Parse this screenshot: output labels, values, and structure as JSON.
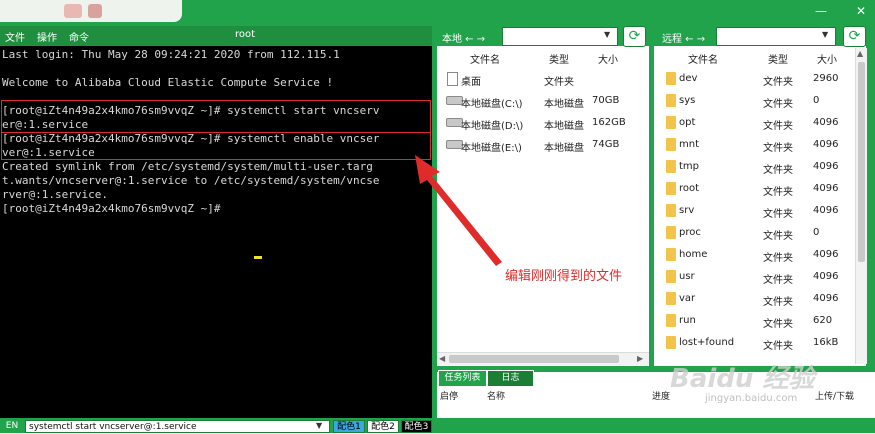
{
  "window": {
    "title": "root",
    "min_glyph": "—",
    "close_glyph": "✕"
  },
  "menu": {
    "items": [
      "文件",
      "操作",
      "命令"
    ]
  },
  "terminal": {
    "lines": [
      "Last login: Thu May 28 09:24:21 2020 from 112.115.1",
      "",
      "Welcome to Alibaba Cloud Elastic Compute Service !",
      "",
      "[root@iZt4n49a2x4kmo76sm9vvqZ ~]# systemctl start vncserv",
      "er@:1.service",
      "[root@iZt4n49a2x4kmo76sm9vvqZ ~]# systemctl enable vncser",
      "ver@:1.service",
      "Created symlink from /etc/systemd/system/multi-user.targ",
      "t.wants/vncserver@:1.service to /etc/systemd/system/vncse",
      "rver@:1.service.",
      "[root@iZt4n49a2x4kmo76sm9vvqZ ~]# "
    ]
  },
  "local": {
    "label": "本地 ← →",
    "path": "",
    "columns": [
      "文件名",
      "类型",
      "大小"
    ],
    "rows": [
      {
        "name": "桌面",
        "type": "文件夹",
        "size": "",
        "icon": "desktop-icon"
      },
      {
        "name": "本地磁盘(C:\\)",
        "type": "本地磁盘",
        "size": "70GB",
        "icon": "disk-icon"
      },
      {
        "name": "本地磁盘(D:\\)",
        "type": "本地磁盘",
        "size": "162GB",
        "icon": "disk-icon"
      },
      {
        "name": "本地磁盘(E:\\)",
        "type": "本地磁盘",
        "size": "74GB",
        "icon": "disk-icon"
      }
    ]
  },
  "remote": {
    "label": "远程 ← →",
    "path": "",
    "columns": [
      "文件名",
      "类型",
      "大小"
    ],
    "rows": [
      {
        "name": "dev",
        "type": "文件夹",
        "size": "2960"
      },
      {
        "name": "sys",
        "type": "文件夹",
        "size": "0"
      },
      {
        "name": "opt",
        "type": "文件夹",
        "size": "4096"
      },
      {
        "name": "mnt",
        "type": "文件夹",
        "size": "4096"
      },
      {
        "name": "tmp",
        "type": "文件夹",
        "size": "4096"
      },
      {
        "name": "root",
        "type": "文件夹",
        "size": "4096"
      },
      {
        "name": "srv",
        "type": "文件夹",
        "size": "4096"
      },
      {
        "name": "proc",
        "type": "文件夹",
        "size": "0"
      },
      {
        "name": "home",
        "type": "文件夹",
        "size": "4096"
      },
      {
        "name": "usr",
        "type": "文件夹",
        "size": "4096"
      },
      {
        "name": "var",
        "type": "文件夹",
        "size": "4096"
      },
      {
        "name": "run",
        "type": "文件夹",
        "size": "620"
      },
      {
        "name": "lost+found",
        "type": "文件夹",
        "size": "16kB"
      }
    ]
  },
  "tasks": {
    "tabs": [
      "任务列表",
      "日志"
    ],
    "columns": [
      "启停",
      "名称",
      "进度",
      "上传/下载"
    ]
  },
  "status": {
    "ime": "EN",
    "command": "systemctl start vncserver@:1.service",
    "configs": [
      "配色1",
      "配色2",
      "配色3"
    ]
  },
  "annotation": {
    "text": "编辑刚刚得到的文件"
  },
  "watermark": {
    "logo": "Baidu 经验",
    "site": "jingyan.baidu.com"
  },
  "colors": {
    "accent": "#21a34b",
    "annotation_red": "#e02b2b",
    "terminal_bg": "#000000",
    "folder": "#f3c44c"
  }
}
